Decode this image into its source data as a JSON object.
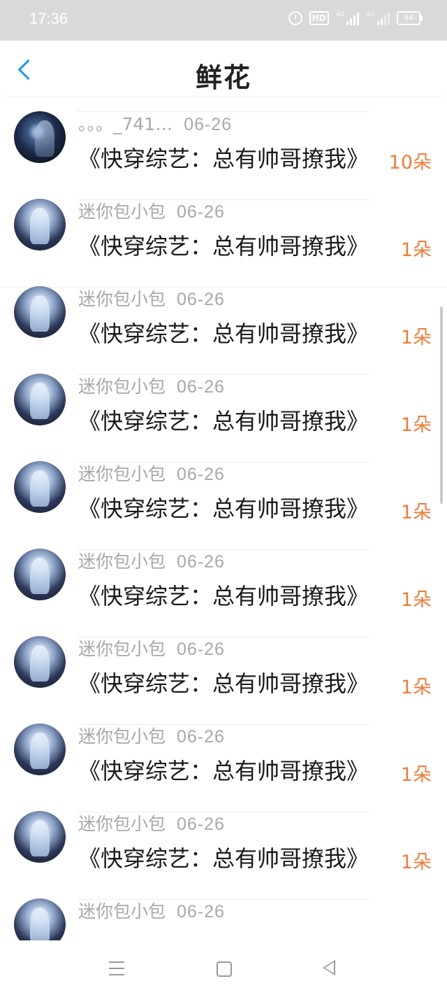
{
  "status_bar": {
    "time": "17:36",
    "hd_label": "HD",
    "network_1": "4G",
    "network_2": "4G",
    "battery": "94"
  },
  "header": {
    "title": "鲜花",
    "back_icon": "chevron-left-icon"
  },
  "colors": {
    "accent": "#1a9be8",
    "count": "#ef7d3c",
    "meta": "#a8a8a8",
    "status_bar": "#d9d9d9"
  },
  "list": [
    {
      "name": "。。。_741…",
      "date": "06-26",
      "book": "《快穿综艺：总有帅哥撩我》",
      "count": "10朵",
      "avatar": "dark"
    },
    {
      "name": "迷你包小包",
      "date": "06-26",
      "book": "《快穿综艺：总有帅哥撩我》",
      "count": "1朵",
      "avatar": "blue"
    },
    {
      "name": "迷你包小包",
      "date": "06-26",
      "book": "《快穿综艺：总有帅哥撩我》",
      "count": "1朵",
      "avatar": "blue"
    },
    {
      "name": "迷你包小包",
      "date": "06-26",
      "book": "《快穿综艺：总有帅哥撩我》",
      "count": "1朵",
      "avatar": "blue"
    },
    {
      "name": "迷你包小包",
      "date": "06-26",
      "book": "《快穿综艺：总有帅哥撩我》",
      "count": "1朵",
      "avatar": "blue"
    },
    {
      "name": "迷你包小包",
      "date": "06-26",
      "book": "《快穿综艺：总有帅哥撩我》",
      "count": "1朵",
      "avatar": "blue"
    },
    {
      "name": "迷你包小包",
      "date": "06-26",
      "book": "《快穿综艺：总有帅哥撩我》",
      "count": "1朵",
      "avatar": "blue"
    },
    {
      "name": "迷你包小包",
      "date": "06-26",
      "book": "《快穿综艺：总有帅哥撩我》",
      "count": "1朵",
      "avatar": "blue"
    },
    {
      "name": "迷你包小包",
      "date": "06-26",
      "book": "《快穿综艺：总有帅哥撩我》",
      "count": "1朵",
      "avatar": "blue"
    },
    {
      "name": "迷你包小包",
      "date": "06-26",
      "book": "",
      "count": "",
      "avatar": "blue"
    }
  ],
  "bottom_nav": {
    "items": [
      "menu-icon",
      "home-icon",
      "back-triangle-icon"
    ]
  }
}
